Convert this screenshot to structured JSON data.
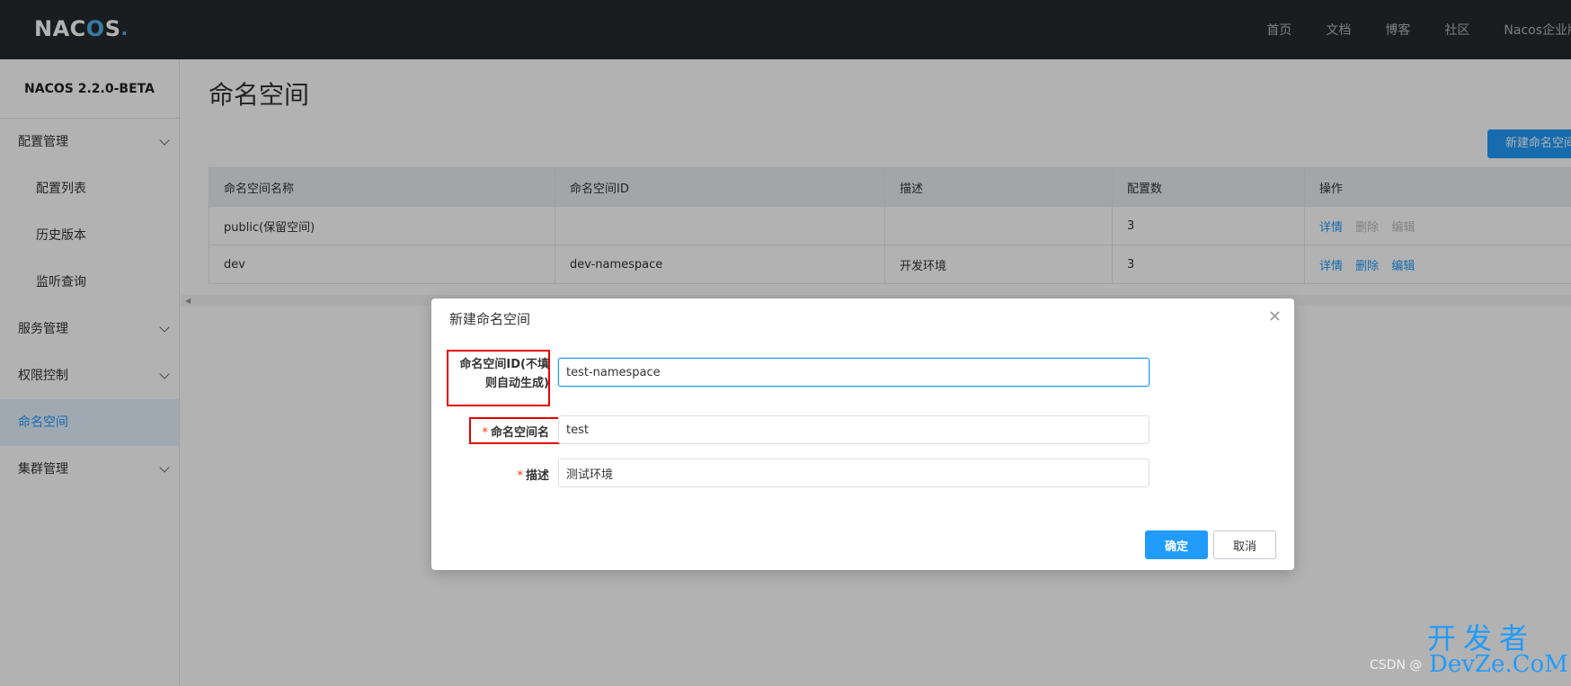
{
  "topbar": {
    "logo": "NACOS.",
    "logo_parts": [
      "NAC",
      "O",
      "S",
      "."
    ],
    "links": [
      "首页",
      "文档",
      "博客",
      "社区",
      "Nacos企业版"
    ]
  },
  "sidebar": {
    "version": "NACOS 2.2.0-BETA",
    "items": [
      {
        "label": "配置管理",
        "type": "group"
      },
      {
        "label": "配置列表",
        "type": "sub"
      },
      {
        "label": "历史版本",
        "type": "sub"
      },
      {
        "label": "监听查询",
        "type": "sub"
      },
      {
        "label": "服务管理",
        "type": "group"
      },
      {
        "label": "权限控制",
        "type": "group"
      },
      {
        "label": "命名空间",
        "type": "active"
      },
      {
        "label": "集群管理",
        "type": "group"
      }
    ]
  },
  "main": {
    "title": "命名空间",
    "new_button": "新建命名空间",
    "table": {
      "headers": [
        "命名空间名称",
        "命名空间ID",
        "描述",
        "配置数",
        "操作"
      ],
      "rows": [
        {
          "name": "public(保留空间)",
          "id": "",
          "desc": "",
          "count": "3",
          "ops": [
            "详情",
            "删除",
            "编辑"
          ]
        },
        {
          "name": "dev",
          "id": "dev-namespace",
          "desc": "开发环境",
          "count": "3",
          "ops": [
            "详情",
            "删除",
            "编辑"
          ]
        }
      ]
    }
  },
  "dialog": {
    "title": "新建命名空间",
    "fields": {
      "id_label_line1": "命名空间ID(不填",
      "id_label_line2": "则自动生成)",
      "id_value": "test-namespace",
      "name_label": "命名空间名",
      "name_value": "test",
      "desc_label": "描述",
      "desc_value": "测试环境"
    },
    "ok": "确定",
    "cancel": "取消"
  },
  "watermark": {
    "csdn": "CSDN @",
    "big": "开发者",
    "dev": "DevZe.CoM"
  },
  "colors": {
    "accent": "#209bfa",
    "topbar": "#252a2f",
    "highlight": "#e60000"
  }
}
